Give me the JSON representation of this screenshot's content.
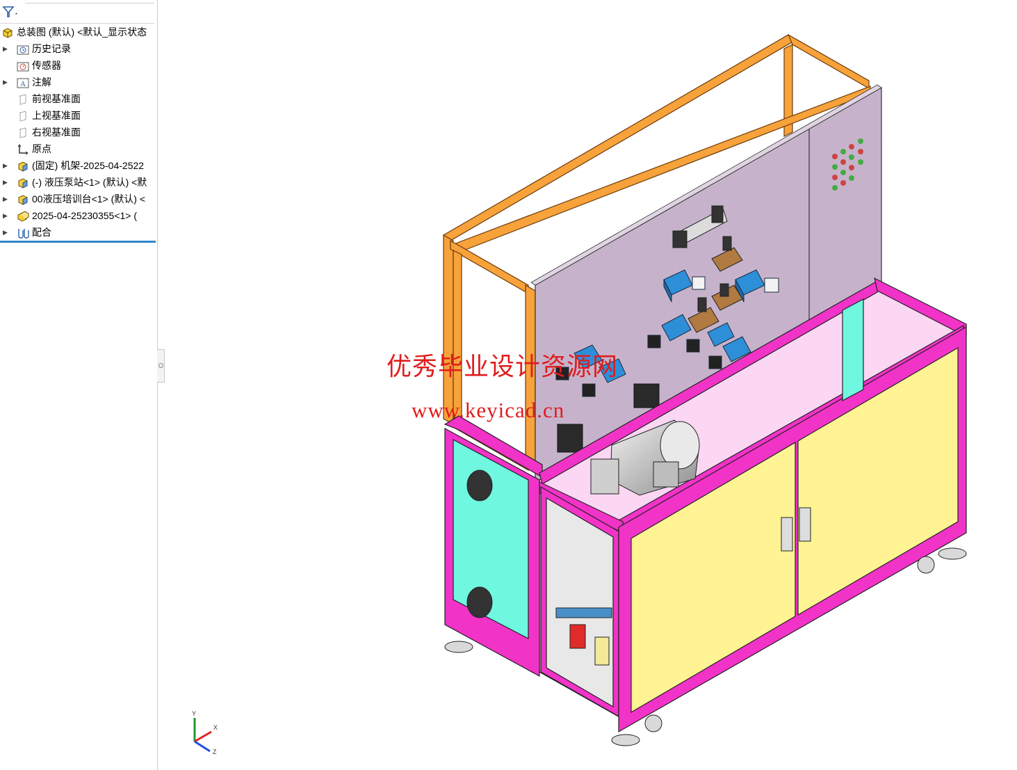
{
  "feature_tree": {
    "filter_icon": "filter-icon",
    "items": [
      {
        "label": "总装图 (默认) <默认_显示状态",
        "icon": "assembly-icon",
        "expandable": false,
        "level": 0
      },
      {
        "label": "历史记录",
        "icon": "history-folder-icon",
        "expandable": true,
        "level": 1
      },
      {
        "label": "传感器",
        "icon": "sensor-folder-icon",
        "expandable": false,
        "level": 1
      },
      {
        "label": "注解",
        "icon": "annotation-folder-icon",
        "expandable": true,
        "level": 1
      },
      {
        "label": "前视基准面",
        "icon": "plane-icon",
        "expandable": false,
        "level": 1
      },
      {
        "label": "上视基准面",
        "icon": "plane-icon",
        "expandable": false,
        "level": 1
      },
      {
        "label": "右视基准面",
        "icon": "plane-icon",
        "expandable": false,
        "level": 1
      },
      {
        "label": "原点",
        "icon": "origin-icon",
        "expandable": false,
        "level": 1
      },
      {
        "label": "(固定) 机架-2025-04-2522",
        "icon": "part-icon",
        "expandable": true,
        "level": 1
      },
      {
        "label": "(-) 液压泵站<1> (默认) <默",
        "icon": "part-icon",
        "expandable": true,
        "level": 1
      },
      {
        "label": "00液压培训台<1> (默认) <",
        "icon": "part-icon",
        "expandable": true,
        "level": 1
      },
      {
        "label": "2025-04-25230355<1> (",
        "icon": "subassembly-icon",
        "expandable": true,
        "level": 1
      },
      {
        "label": "配合",
        "icon": "mates-icon",
        "expandable": true,
        "level": 1
      }
    ]
  },
  "viewport": {
    "watermark_line1": "优秀毕业设计资源网",
    "watermark_line2": "www.keyicad.cn",
    "triad": {
      "x": "X",
      "y": "Y",
      "z": "Z"
    }
  },
  "colors": {
    "frame_orange": "#f7a23a",
    "frame_magenta": "#f233c8",
    "door_yellow": "#fff393",
    "panel_cyan": "#6ff7e0",
    "board_lilac": "#c6b3cb",
    "valve_blue": "#2e8fd9",
    "watermark_red": "#e11c1c",
    "selection_blue": "#2f86c8"
  }
}
